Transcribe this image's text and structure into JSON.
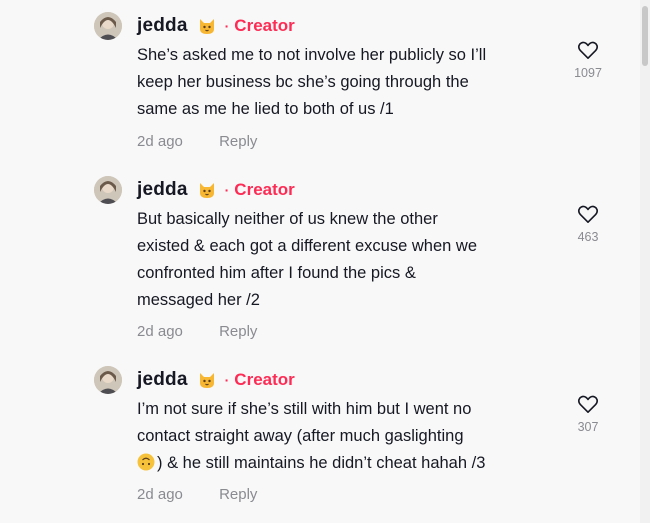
{
  "comments": [
    {
      "username": "jedda",
      "emoji": "cat-face-emoji",
      "separator": "·",
      "badge": "Creator",
      "lines": [
        "She’s asked me to not involve her publicly so I’ll",
        "keep her business bc she’s going through the",
        "same as me he lied to both of us /1"
      ],
      "time": "2d ago",
      "reply": "Reply",
      "likes": "1097"
    },
    {
      "username": "jedda",
      "emoji": "cat-face-emoji",
      "separator": "·",
      "badge": "Creator",
      "lines": [
        "But basically neither of us knew the other",
        "existed & each got a different excuse when we",
        "confronted him after I found the pics &",
        "messaged her /2"
      ],
      "time": "2d ago",
      "reply": "Reply",
      "likes": "463"
    },
    {
      "username": "jedda",
      "emoji": "cat-face-emoji",
      "separator": "·",
      "badge": "Creator",
      "lines": [
        "I’m not sure if she’s still with him but I went no",
        "contact straight away (after much gaslighting",
        ") & he still maintains he didn’t cheat hahah /3"
      ],
      "third_line_emoji": "upside-down-face-emoji",
      "time": "2d ago",
      "reply": "Reply",
      "likes": "307"
    }
  ],
  "colors": {
    "background": "#f8f8f8",
    "text": "#161823",
    "creator": "#fe2c55",
    "muted": "#8a8b91"
  }
}
